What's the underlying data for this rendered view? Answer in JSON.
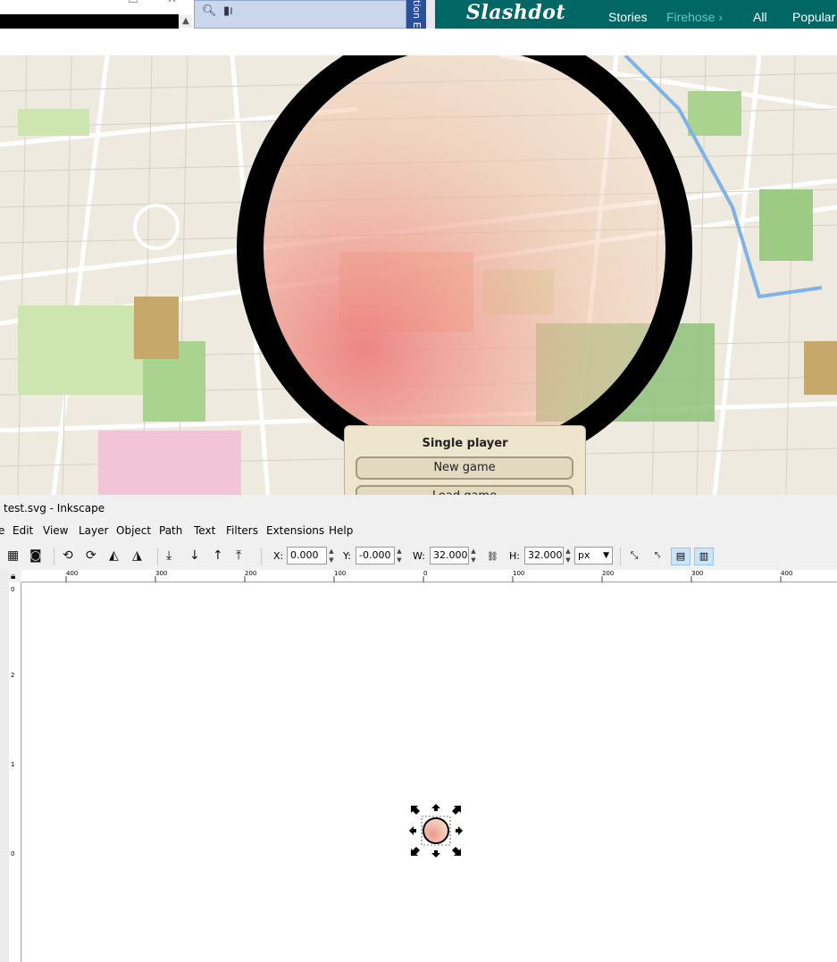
{
  "browser": {
    "window_controls": [
      "–",
      "☐",
      "✕"
    ],
    "side_tab_text": "tion E"
  },
  "slashdot": {
    "logo": "Slashdot",
    "nav": [
      {
        "label": "Stories"
      },
      {
        "label": "Firehose ›"
      },
      {
        "label": "All"
      },
      {
        "label": "Popular"
      }
    ]
  },
  "game": {
    "menu_title": "Single player",
    "new_game": "New game",
    "load_game": "Load game"
  },
  "inkscape": {
    "title": "test.svg - Inkscape",
    "menus": [
      "Edit",
      "View",
      "Layer",
      "Object",
      "Path",
      "Text",
      "Filters",
      "Extensions",
      "Help"
    ],
    "x_label": "X:",
    "x_value": "0.000",
    "y_label": "Y:",
    "y_value": "-0.000",
    "w_label": "W:",
    "w_value": "32.000",
    "h_label": "H:",
    "h_value": "32.000",
    "unit": "px",
    "ruler_ticks": [
      "400",
      "300",
      "200",
      "100",
      "0",
      "100",
      "200",
      "300",
      "400"
    ],
    "vruler_ticks": [
      "0",
      "2",
      "1",
      "0"
    ]
  },
  "colors": {
    "slashdot_bar": "#016765",
    "firehose_link": "#5ec7c9",
    "menu_bg": "#ede5cd",
    "ring": "#000000"
  }
}
